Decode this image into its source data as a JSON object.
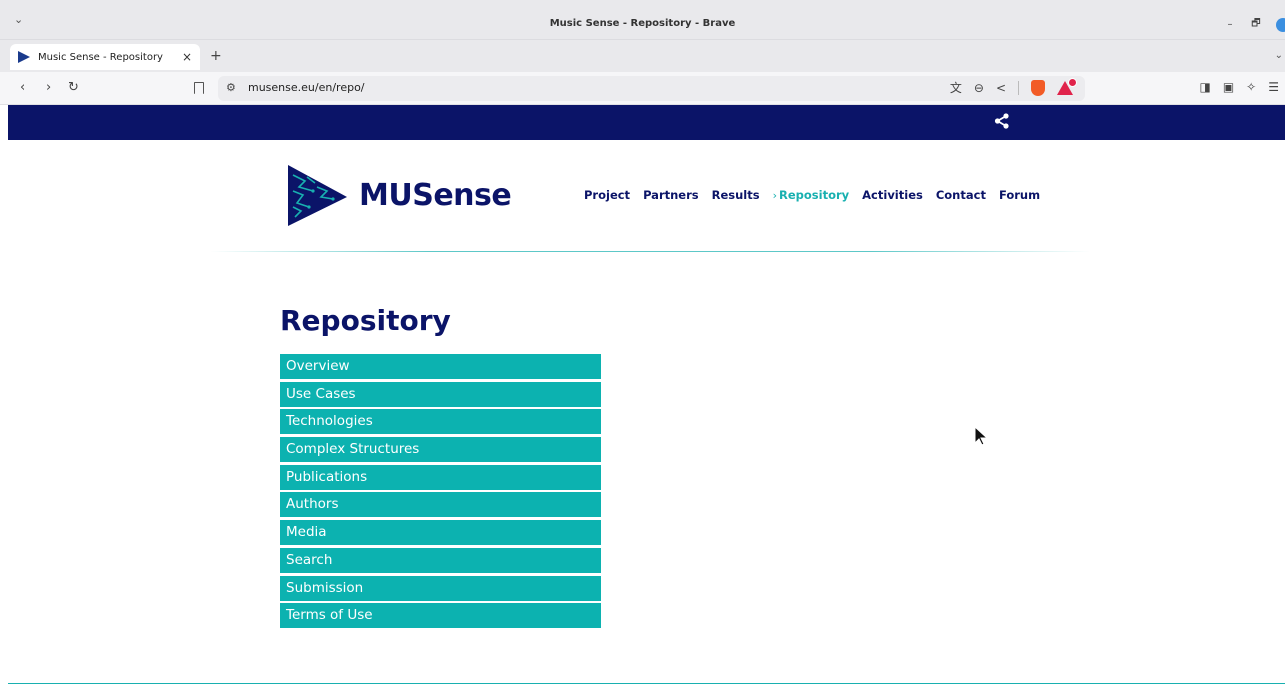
{
  "window": {
    "title": "Music Sense - Repository - Brave",
    "minimize": "–",
    "restore": "🗗"
  },
  "tabs": [
    {
      "title": "Music Sense - Repository",
      "close": "×"
    }
  ],
  "new_tab": "+",
  "address_bar": {
    "url": "musense.eu/en/repo/"
  },
  "site": {
    "logo_text": "MUSense",
    "nav": [
      {
        "label": "Project"
      },
      {
        "label": "Partners"
      },
      {
        "label": "Results"
      },
      {
        "label": "Repository",
        "active": true
      },
      {
        "label": "Activities"
      },
      {
        "label": "Contact"
      },
      {
        "label": "Forum"
      }
    ],
    "active_marker": "›",
    "page_title": "Repository",
    "repo_menu": [
      "Overview",
      "Use Cases",
      "Technologies",
      "Complex Structures",
      "Publications",
      "Authors",
      "Media",
      "Search",
      "Submission",
      "Terms of Use"
    ]
  },
  "colors": {
    "brand_navy": "#0b1468",
    "accent_teal": "#18b0b0",
    "menu_teal": "#0cb2b0"
  }
}
